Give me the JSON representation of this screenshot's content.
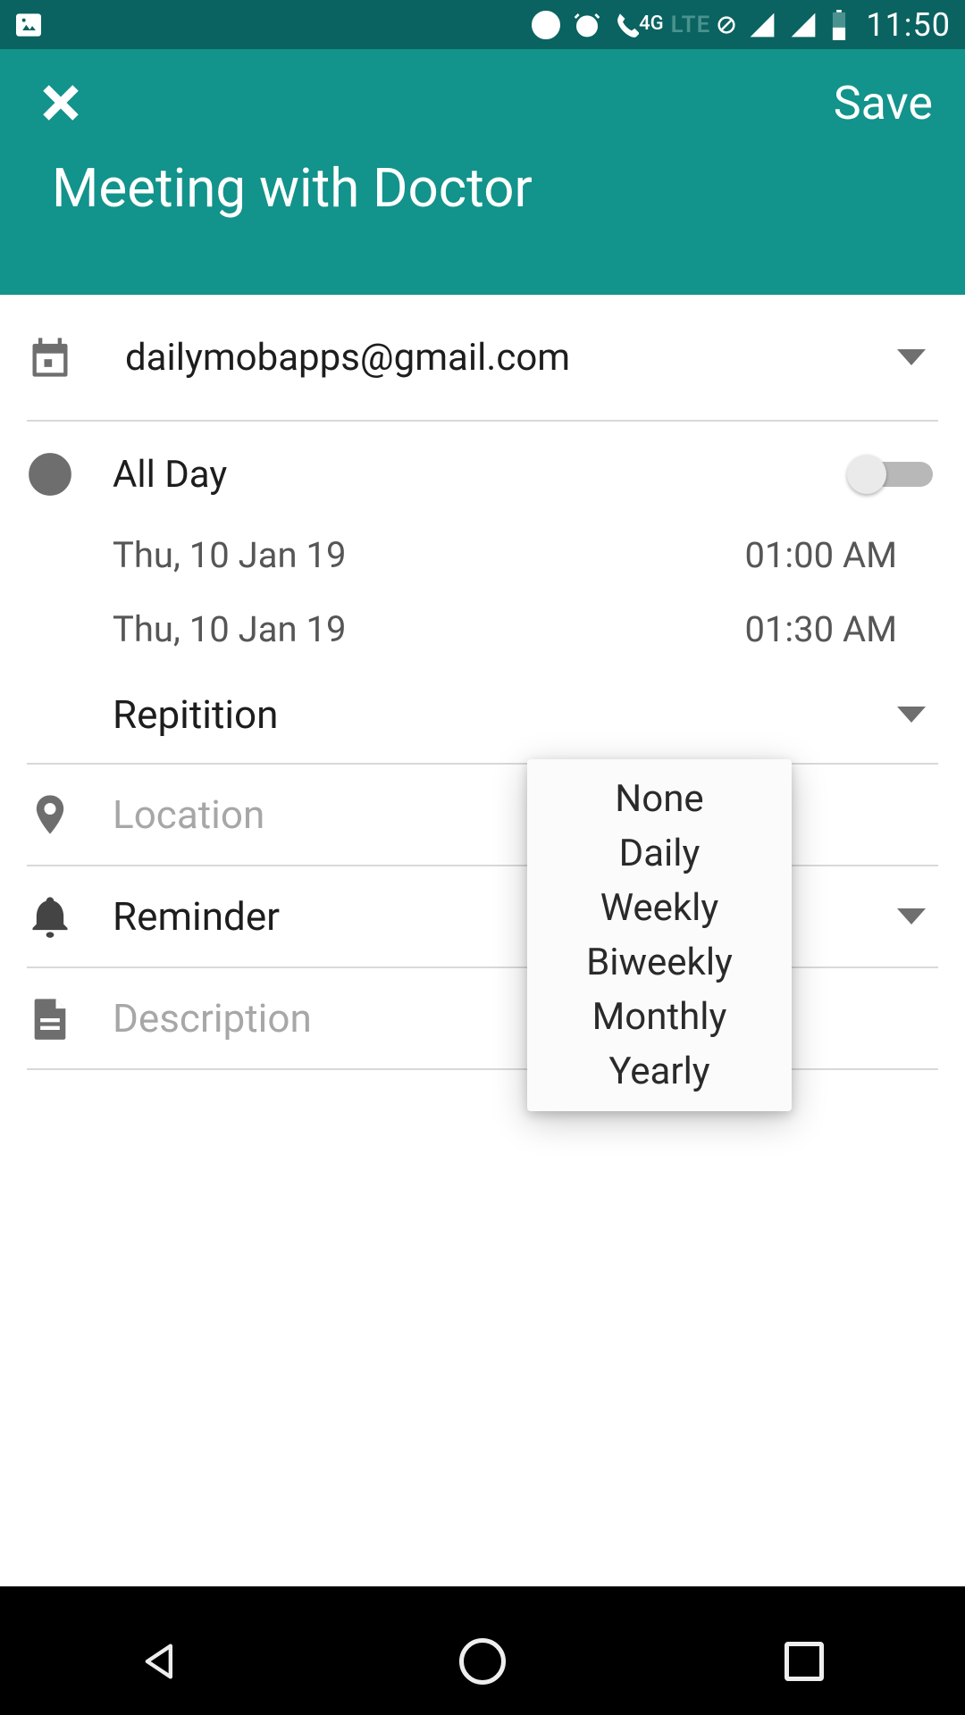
{
  "status": {
    "time": "11:50",
    "fourg": "4G",
    "lte": "LTE"
  },
  "appbar": {
    "save": "Save",
    "title": "Meeting with Doctor"
  },
  "account": {
    "email": "dailymobapps@gmail.com"
  },
  "time": {
    "allday_label": "All Day",
    "start_date": "Thu, 10 Jan 19",
    "start_time": "01:00 AM",
    "end_date": "Thu, 10 Jan 19",
    "end_time": "01:30 AM",
    "repetition_label": "Repitition"
  },
  "location": {
    "placeholder": "Location"
  },
  "reminder": {
    "label": "Reminder"
  },
  "description": {
    "placeholder": "Description"
  },
  "popup": {
    "opt0": "None",
    "opt1": "Daily",
    "opt2": "Weekly",
    "opt3": "Biweekly",
    "opt4": "Monthly",
    "opt5": "Yearly"
  }
}
